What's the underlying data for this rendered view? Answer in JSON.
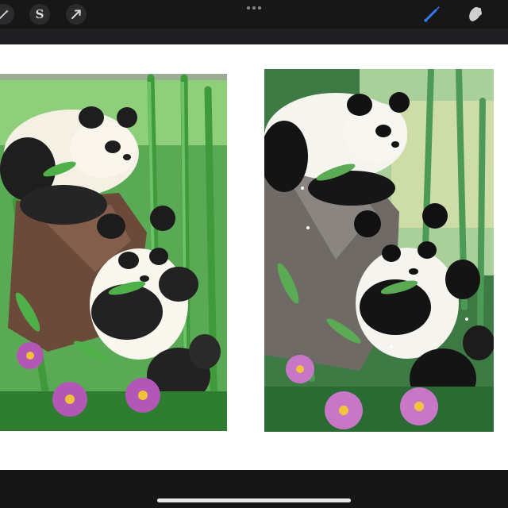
{
  "toolbar": {
    "left_tools": [
      {
        "icon": "magic-wand-icon"
      },
      {
        "icon": "selection-s-icon",
        "glyph": "S"
      },
      {
        "icon": "transform-arrow-icon"
      }
    ],
    "menu_icon": "more-dots-icon",
    "right_tools": [
      {
        "icon": "brush-icon",
        "active_color": "#2f7cf6"
      },
      {
        "icon": "smudge-icon"
      }
    ]
  },
  "canvas": {
    "background": "#ffffff",
    "artworks": [
      {
        "name": "sketch-panda-painting",
        "palette": [
          "#3aa14a",
          "#1d1d1d",
          "#f4f0e6",
          "#b04fb8",
          "#7b5a45"
        ]
      },
      {
        "name": "finished-panda-painting",
        "palette": [
          "#2e7d3a",
          "#111111",
          "#f6f4ef",
          "#c870c4",
          "#6a6a6a"
        ]
      }
    ]
  },
  "home_indicator_color": "#e8e8e8"
}
